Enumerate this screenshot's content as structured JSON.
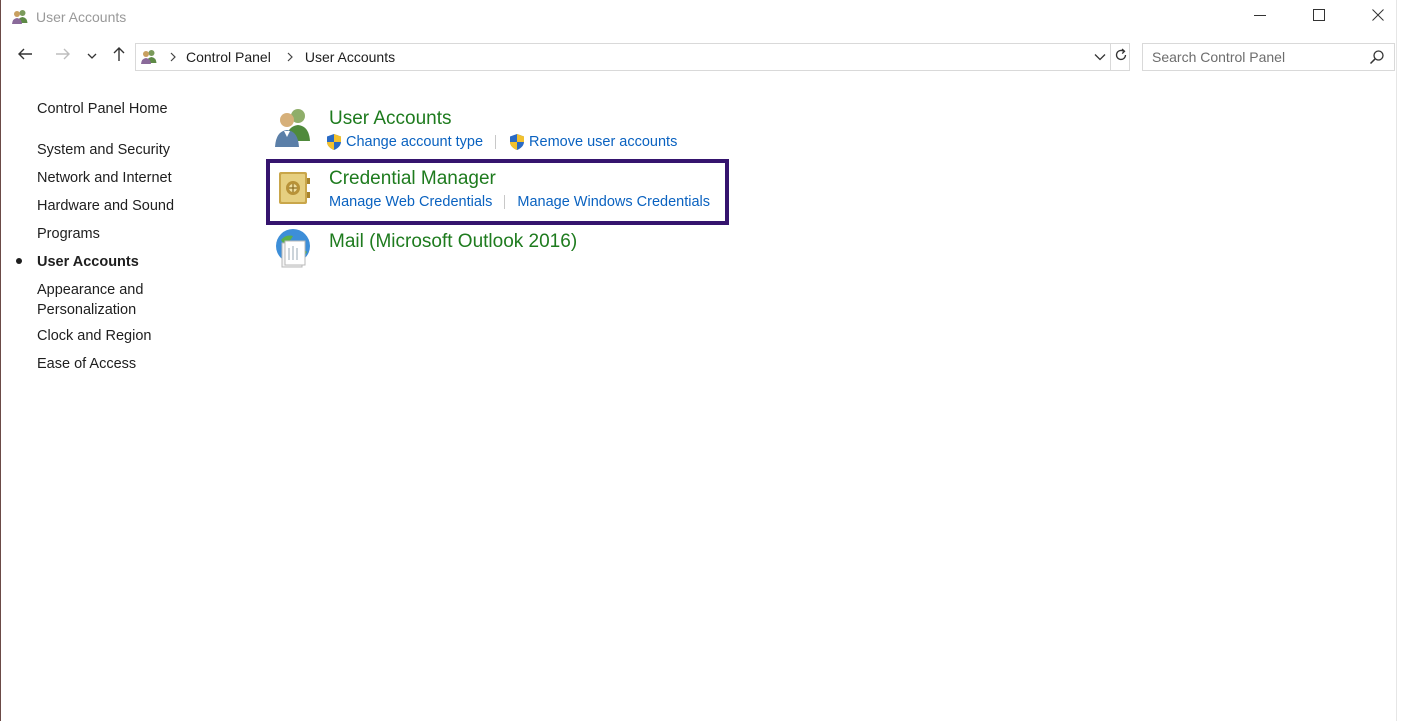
{
  "window": {
    "title": "User Accounts",
    "title_icon": "users-icon",
    "controls": [
      "minimize-icon",
      "maximize-icon",
      "close-icon"
    ]
  },
  "address": {
    "icon": "users-icon",
    "crumbs": [
      "Control Panel",
      "User Accounts"
    ]
  },
  "search": {
    "placeholder": "Search Control Panel",
    "value": ""
  },
  "sidebar": {
    "home": "Control Panel Home",
    "items": [
      {
        "label": "System and Security",
        "current": false
      },
      {
        "label": "Network and Internet",
        "current": false
      },
      {
        "label": "Hardware and Sound",
        "current": false
      },
      {
        "label": "Programs",
        "current": false
      },
      {
        "label": "User Accounts",
        "current": true
      },
      {
        "label": "Appearance and",
        "label_line2": "Personalization",
        "current": false
      },
      {
        "label": "Clock and Region",
        "current": false
      },
      {
        "label": "Ease of Access",
        "current": false
      }
    ]
  },
  "categories": [
    {
      "title": "User Accounts",
      "icon": "user-accounts-icon",
      "links": [
        {
          "label": "Change account type",
          "icon": "uac-shield-icon"
        },
        {
          "label": "Remove user accounts",
          "icon": "uac-shield-icon"
        }
      ]
    },
    {
      "title": "Credential Manager",
      "icon": "vault-icon",
      "highlighted": true,
      "links": [
        {
          "label": "Manage Web Credentials"
        },
        {
          "label": "Manage Windows Credentials"
        }
      ]
    },
    {
      "title": "Mail (Microsoft Outlook 2016)",
      "icon": "mail-icon",
      "links": []
    }
  ],
  "colors": {
    "category_title": "#1e7b1e",
    "link": "#0a62c0",
    "highlight_border": "#35146e"
  }
}
